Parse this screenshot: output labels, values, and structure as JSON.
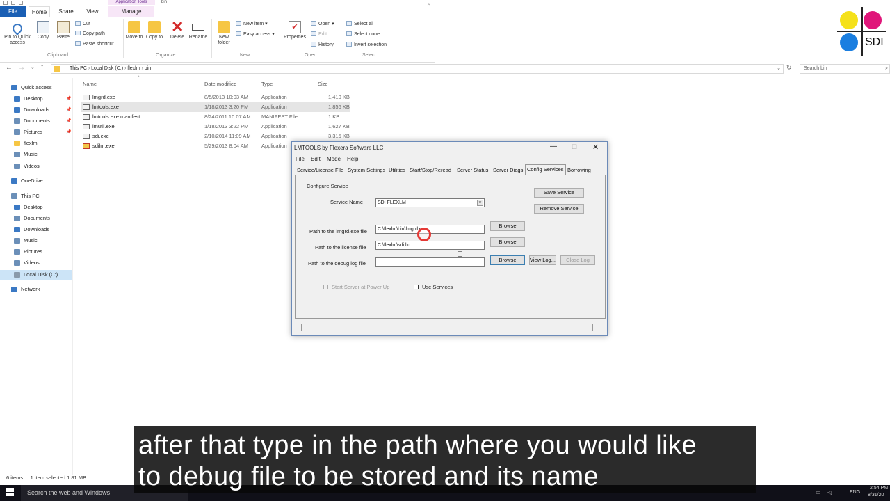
{
  "ribbon": {
    "tabs": [
      "File",
      "Home",
      "Share",
      "View",
      "Manage"
    ],
    "context_tab": "Application Tools",
    "window_title": "bin",
    "clipboard": {
      "pin": "Pin to Quick access",
      "copy": "Copy",
      "paste": "Paste",
      "cut": "Cut",
      "copy_path": "Copy path",
      "paste_shortcut": "Paste shortcut",
      "group": "Clipboard"
    },
    "organize": {
      "move": "Move to",
      "copy": "Copy to",
      "delete": "Delete",
      "rename": "Rename",
      "group": "Organize"
    },
    "new": {
      "folder": "New folder",
      "new_item": "New item",
      "easy_access": "Easy access",
      "group": "New"
    },
    "open": {
      "properties": "Properties",
      "open": "Open",
      "edit": "Edit",
      "history": "History",
      "group": "Open"
    },
    "select": {
      "all": "Select all",
      "none": "Select none",
      "invert": "Invert selection",
      "group": "Select"
    }
  },
  "address": {
    "path": [
      "This PC",
      "Local Disk (C:)",
      "flexlm",
      "bin"
    ],
    "search_placeholder": "Search bin"
  },
  "nav": {
    "items": [
      "Quick access",
      "Desktop",
      "Downloads",
      "Documents",
      "Pictures",
      "flexlm",
      "Music",
      "Videos",
      "OneDrive",
      "This PC",
      "Desktop",
      "Documents",
      "Downloads",
      "Music",
      "Pictures",
      "Videos",
      "Local Disk (C:)",
      "Network"
    ]
  },
  "files": {
    "headers": {
      "name": "Name",
      "date": "Date modified",
      "type": "Type",
      "size": "Size"
    },
    "rows": [
      {
        "name": "lmgrd.exe",
        "date": "8/5/2013 10:03 AM",
        "type": "Application",
        "size": "1,410 KB"
      },
      {
        "name": "lmtools.exe",
        "date": "1/18/2013 3:20 PM",
        "type": "Application",
        "size": "1,856 KB"
      },
      {
        "name": "lmtools.exe.manifest",
        "date": "8/24/2011 10:07 AM",
        "type": "MANIFEST File",
        "size": "1 KB"
      },
      {
        "name": "lmutil.exe",
        "date": "1/18/2013 3:22 PM",
        "type": "Application",
        "size": "1,627 KB"
      },
      {
        "name": "sdi.exe",
        "date": "2/10/2014 11:09 AM",
        "type": "Application",
        "size": "3,315 KB"
      },
      {
        "name": "sdilm.exe",
        "date": "5/29/2013 8:04 AM",
        "type": "Application",
        "size": ""
      }
    ]
  },
  "status": {
    "count": "6 items",
    "selected": "1 item selected  1.81 MB"
  },
  "dialog": {
    "title": "LMTOOLS by Flexera Software LLC",
    "menu": [
      "File",
      "Edit",
      "Mode",
      "Help"
    ],
    "tabs": [
      "Service/License File",
      "System Settings",
      "Utilities",
      "Start/Stop/Reread",
      "Server Status",
      "Server Diags",
      "Config Services",
      "Borrowing"
    ],
    "active_tab": "Config Services",
    "section": "Configure Service",
    "service_name_label": "Service Name",
    "service_name": "SDI FLEXLM",
    "save": "Save Service",
    "remove": "Remove Service",
    "lmgrd_label": "Path to the lmgrd.exe file",
    "lmgrd_value": "C:\\flexlm\\bin\\lmgrd.exe",
    "license_label": "Path to the license file",
    "license_value": "C:\\flexlm\\sdi.lic",
    "debug_label": "Path to the debug log file",
    "debug_value": "",
    "browse": "Browse",
    "view_log": "View Log...",
    "close_log": "Close Log",
    "start_power": "Start Server at Power Up",
    "use_services": "Use Services"
  },
  "logo": {
    "text": "SDI",
    "colors": [
      "#f5e11a",
      "#e0167a",
      "#1a7ee0"
    ]
  },
  "taskbar": {
    "search": "Search the web and Windows",
    "time": "2:54 PM",
    "date": "8/31/20",
    "lang": "ENG"
  },
  "caption": {
    "line1": "after that type in the path where you would like",
    "line2": "to debug file to be stored and its name"
  }
}
